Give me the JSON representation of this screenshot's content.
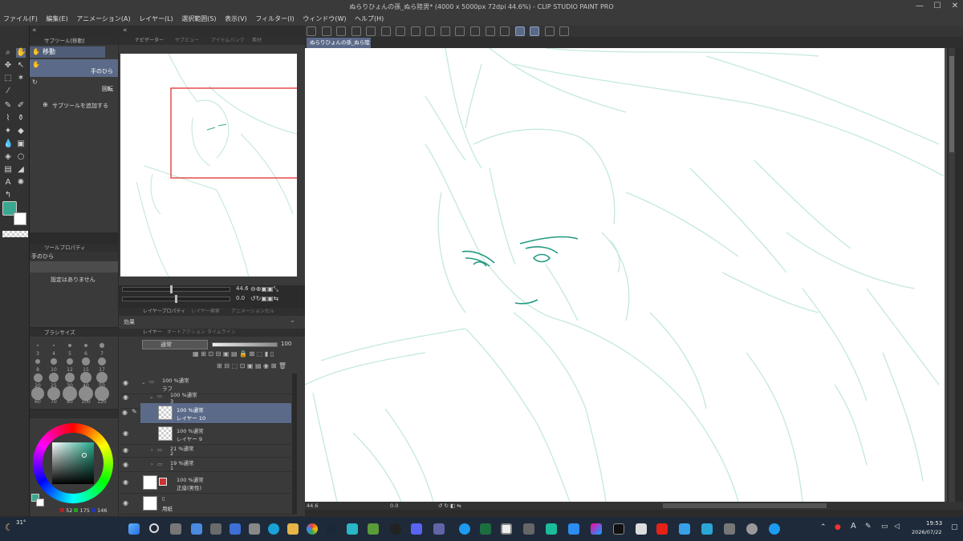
{
  "window": {
    "title": "ぬらりひょんの孫_ぬら陸男* (4000 x 5000px 72dpi 44.6%) - CLIP STUDIO PAINT PRO",
    "menu": [
      "ファイル(F)",
      "編集(E)",
      "アニメーション(A)",
      "レイヤー(L)",
      "選択範囲(S)",
      "表示(V)",
      "フィルター(I)",
      "ウィンドウ(W)",
      "ヘルプ(H)"
    ]
  },
  "document_tab": {
    "label": "ぬらりひょんの孫_ぬら陸男*"
  },
  "subtool": {
    "header": "サブツール[移動]",
    "group_label": "移動",
    "items": [
      {
        "label": "手のひら"
      },
      {
        "label": "回転"
      }
    ],
    "add_label": "サブツールを追加する"
  },
  "navigator": {
    "tabs": [
      "ナビゲーター",
      "サブビュー",
      "アイテムバンク",
      "素材"
    ],
    "zoom": "44.6",
    "angle": "0.0"
  },
  "tool_property": {
    "header": "ツールプロパティ",
    "tool_name": "手のひら",
    "empty_message": "設定はありません"
  },
  "brush_size": {
    "header": "ブラシサイズ",
    "sizes": [
      "3",
      "4",
      "5",
      "6",
      "7",
      "8",
      "10",
      "12",
      "15",
      "17",
      "20",
      "25",
      "30",
      "40",
      "50",
      "60",
      "70",
      "80",
      "100",
      "120"
    ]
  },
  "layer_property": {
    "tabs": [
      "レイヤープロパティ",
      "レイヤー検索",
      "アニメーションセル"
    ],
    "effect_label": "効果"
  },
  "layers_panel": {
    "tabs": [
      "レイヤー",
      "オートアクション",
      "タイムライン"
    ],
    "blend_mode": "通常",
    "opacity": "100",
    "layers": [
      {
        "blend": "100 %通常",
        "name": "ラフ"
      },
      {
        "blend": "100 %通常",
        "name": "3"
      },
      {
        "blend": "100 %通常",
        "name": "レイヤー 10"
      },
      {
        "blend": "100 %通常",
        "name": "レイヤー 9"
      },
      {
        "blend": "21 %通常",
        "name": "2"
      },
      {
        "blend": "19 %通常",
        "name": "1"
      },
      {
        "blend": "100 %通常",
        "name": "正座(男性)"
      },
      {
        "blend": "",
        "name": "用紙"
      }
    ]
  },
  "color": {
    "main_color": "#3aa891",
    "accent": "#5b6a88",
    "rgb": [
      "52",
      "175",
      "146"
    ]
  },
  "canvas_status": {
    "zoom": "44.6",
    "angle": "0.0"
  },
  "taskbar": {
    "weather": "31°",
    "time": "19:53",
    "date": "2026/07/22",
    "ime": "A"
  }
}
